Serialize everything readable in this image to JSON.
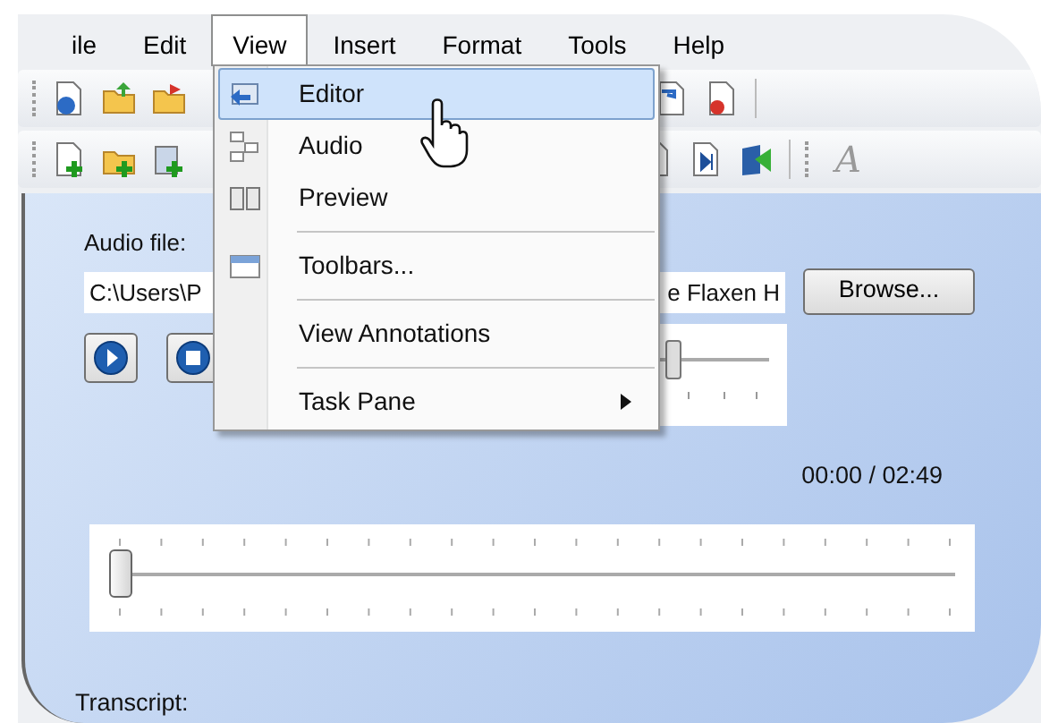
{
  "menubar": [
    {
      "label": "ile",
      "selected": false
    },
    {
      "label": "Edit",
      "selected": false
    },
    {
      "label": "View",
      "selected": true
    },
    {
      "label": "Insert",
      "selected": false
    },
    {
      "label": "Format",
      "selected": false
    },
    {
      "label": "Tools",
      "selected": false
    },
    {
      "label": "Help",
      "selected": false
    }
  ],
  "toolbar": {
    "font_glyph": "A"
  },
  "view_menu": {
    "items": [
      {
        "kind": "item",
        "label": "Editor",
        "selected": true,
        "has_icon": true
      },
      {
        "kind": "item",
        "label": "Audio",
        "selected": false,
        "has_icon": true
      },
      {
        "kind": "item",
        "label": "Preview",
        "selected": false,
        "has_icon": true
      },
      {
        "kind": "separator"
      },
      {
        "kind": "item",
        "label": "Toolbars...",
        "selected": false,
        "has_icon": true
      },
      {
        "kind": "separator"
      },
      {
        "kind": "item",
        "label": "View Annotations",
        "selected": false,
        "has_icon": false
      },
      {
        "kind": "separator"
      },
      {
        "kind": "item",
        "label": "Task Pane",
        "selected": false,
        "has_icon": false,
        "submenu": true
      }
    ]
  },
  "panel": {
    "audio_file_label": "Audio file:",
    "audio_file_path": {
      "visible_start": "C:\\Users\\P",
      "visible_end": "e Flaxen H"
    },
    "browse_button": "Browse...",
    "volume_slider": {
      "level": 0.69
    },
    "time": "00:00 / 02:49",
    "position_slider": {
      "level": 0
    },
    "transcript_label": "Transcript:"
  }
}
